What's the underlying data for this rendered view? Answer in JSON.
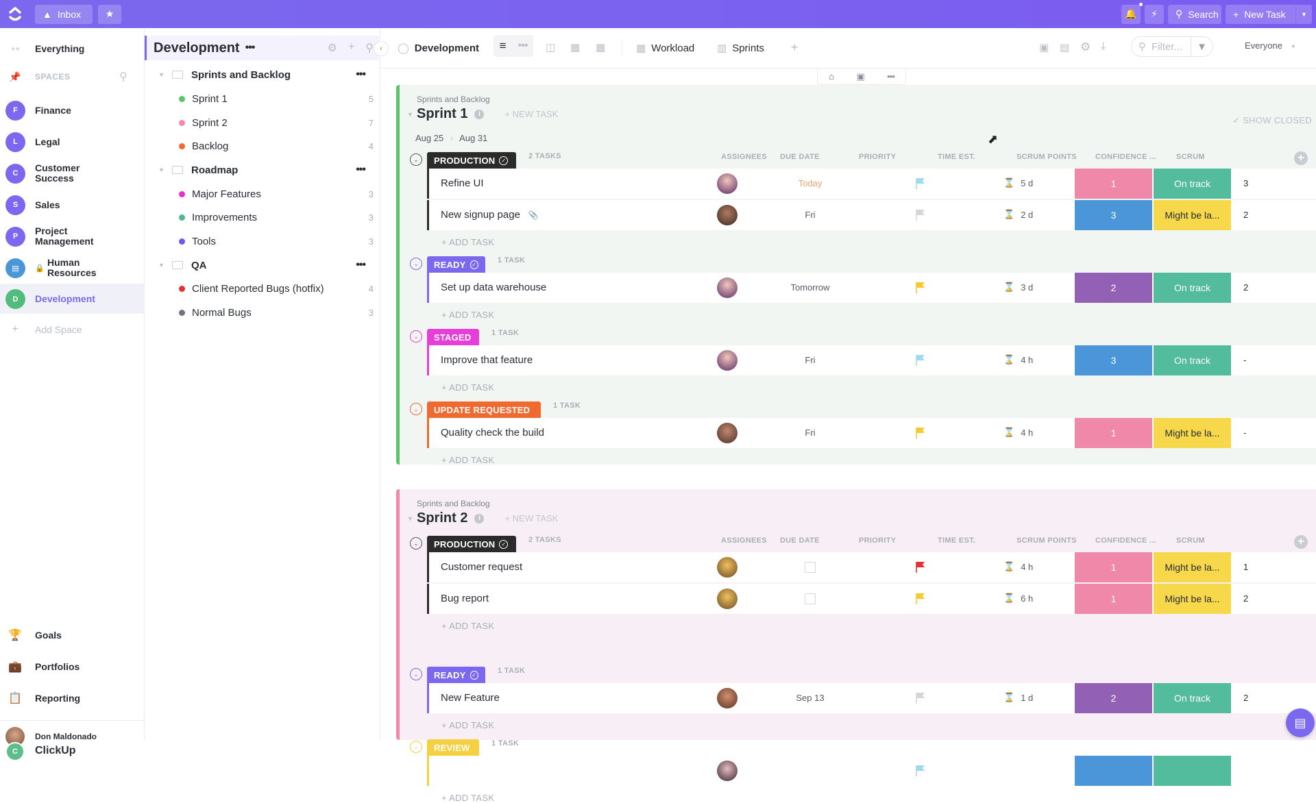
{
  "topbar": {
    "inbox_label": "Inbox",
    "search_label": "Search",
    "new_task_label": "New Task"
  },
  "sidebar": {
    "everything_label": "Everything",
    "spaces_label": "SPACES",
    "spaces": [
      {
        "initial": "F",
        "label": "Finance"
      },
      {
        "initial": "L",
        "label": "Legal"
      },
      {
        "initial": "C",
        "label": "Customer Success"
      },
      {
        "initial": "S",
        "label": "Sales"
      },
      {
        "initial": "P",
        "label": "Project Management"
      },
      {
        "initial": "",
        "label": "Human Resources",
        "locked": true
      },
      {
        "initial": "D",
        "label": "Development",
        "active": true
      }
    ],
    "add_space_label": "Add Space",
    "bottom_items": [
      {
        "icon": "trophy-icon",
        "label": "Goals"
      },
      {
        "icon": "briefcase-icon",
        "label": "Portfolios"
      },
      {
        "icon": "clipboard-icon",
        "label": "Reporting"
      }
    ],
    "user_name": "Don Maldonado",
    "workspace_initial": "C",
    "workspace_name": "ClickUp"
  },
  "tree": {
    "title": "Development",
    "folders": [
      {
        "label": "Sprints and Backlog",
        "lists": [
          {
            "label": "Sprint 1",
            "count": "5",
            "color": "#5bc46b"
          },
          {
            "label": "Sprint 2",
            "count": "7",
            "color": "#f08aa8"
          },
          {
            "label": "Backlog",
            "count": "4",
            "color": "#f06a30"
          }
        ]
      },
      {
        "label": "Roadmap",
        "lists": [
          {
            "label": "Major Features",
            "count": "3",
            "color": "#e830d0"
          },
          {
            "label": "Improvements",
            "count": "3",
            "color": "#4fb890"
          },
          {
            "label": "Tools",
            "count": "3",
            "color": "#6a5af0"
          }
        ]
      },
      {
        "label": "QA",
        "lists": [
          {
            "label": "Client Reported Bugs (hotfix)",
            "count": "4",
            "color": "#e83030"
          },
          {
            "label": "Normal Bugs",
            "count": "3",
            "color": "#707482"
          }
        ]
      }
    ]
  },
  "viewbar": {
    "space_label": "Development",
    "workload_label": "Workload",
    "sprints_label": "Sprints",
    "filter_placeholder": "Filter...",
    "everyone_label": "Everyone"
  },
  "columns": {
    "assignees": "ASSIGNEES",
    "due_date": "DUE DATE",
    "priority": "PRIORITY",
    "time_est": "TIME EST.",
    "scrum_points": "SCRUM POINTS",
    "confidence": "CONFIDENCE ...",
    "scrum": "SCRUM"
  },
  "labels": {
    "new_task": "+ NEW TASK",
    "add_task": "+ ADD TASK",
    "show_closed": "✓ SHOW CLOSED"
  },
  "sprints": [
    {
      "crumb": "Sprints and Backlog",
      "title": "Sprint 1",
      "date_start": "Aug 25",
      "date_end": "Aug 31",
      "groups": [
        {
          "status": "PRODUCTION",
          "color": "#2b2b2b",
          "count": "2 TASKS",
          "tasks": [
            {
              "name": "Refine UI",
              "due": "Today",
              "due_color": "#f0a070",
              "priority_color": "#a0d8f0",
              "time": "5 d",
              "points": "1",
              "points_color": "#f088aa",
              "confidence": "On track",
              "conf_color": "#52bc9c",
              "scrum": "3"
            },
            {
              "name": "New signup page",
              "attachment": true,
              "due": "Fri",
              "priority_color": "#d3d6db",
              "time": "2 d",
              "points": "3",
              "points_color": "#4a96d8",
              "confidence": "Might be la...",
              "conf_color": "#f7d84a",
              "scrum": "2"
            }
          ]
        },
        {
          "status": "READY",
          "color": "#7b68ee",
          "count": "1 TASK",
          "tasks": [
            {
              "name": "Set up data warehouse",
              "due": "Tomorrow",
              "priority_color": "#f7c930",
              "time": "3 d",
              "points": "2",
              "points_color": "#9260b5",
              "confidence": "On track",
              "conf_color": "#52bc9c",
              "scrum": "2"
            }
          ]
        },
        {
          "status": "STAGED",
          "color": "#e83ed8",
          "count": "1 TASK",
          "tasks": [
            {
              "name": "Improve that feature",
              "due": "Fri",
              "priority_color": "#a0d8f0",
              "time": "4 h",
              "points": "3",
              "points_color": "#4a96d8",
              "confidence": "On track",
              "conf_color": "#52bc9c",
              "scrum": "-"
            }
          ]
        },
        {
          "status": "UPDATE REQUESTED",
          "color": "#f06a30",
          "count": "1 TASK",
          "tasks": [
            {
              "name": "Quality check the build",
              "due": "Fri",
              "priority_color": "#f7c930",
              "time": "4 h",
              "points": "1",
              "points_color": "#f088aa",
              "confidence": "Might be la...",
              "conf_color": "#f7d84a",
              "scrum": "-"
            }
          ]
        }
      ]
    },
    {
      "crumb": "Sprints and Backlog",
      "title": "Sprint 2",
      "groups": [
        {
          "status": "PRODUCTION",
          "color": "#2b2b2b",
          "count": "2 TASKS",
          "tasks": [
            {
              "name": "Customer request",
              "due": "",
              "priority_color": "#e83030",
              "time": "4 h",
              "points": "1",
              "points_color": "#f088aa",
              "confidence": "Might be la...",
              "conf_color": "#f7d84a",
              "scrum": "1"
            },
            {
              "name": "Bug report",
              "due": "",
              "priority_color": "#f7c930",
              "time": "6 h",
              "points": "1",
              "points_color": "#f088aa",
              "confidence": "Might be la...",
              "conf_color": "#f7d84a",
              "scrum": "2"
            }
          ]
        },
        {
          "status": "READY",
          "color": "#7b68ee",
          "count": "1 TASK",
          "tasks": [
            {
              "name": "New Feature",
              "due": "Sep 13",
              "priority_color": "#d3d6db",
              "time": "1 d",
              "points": "2",
              "points_color": "#9260b5",
              "confidence": "On track",
              "conf_color": "#52bc9c",
              "scrum": "2"
            }
          ]
        },
        {
          "status": "REVIEW",
          "color": "#f7d040",
          "count": "1 TASK",
          "tasks": [
            {
              "name": "",
              "due": "",
              "priority_color": "#a0d8f0",
              "time": "",
              "points": "",
              "points_color": "#4a96d8",
              "confidence": "",
              "conf_color": "#52bc9c",
              "scrum": ""
            }
          ]
        }
      ]
    }
  ]
}
